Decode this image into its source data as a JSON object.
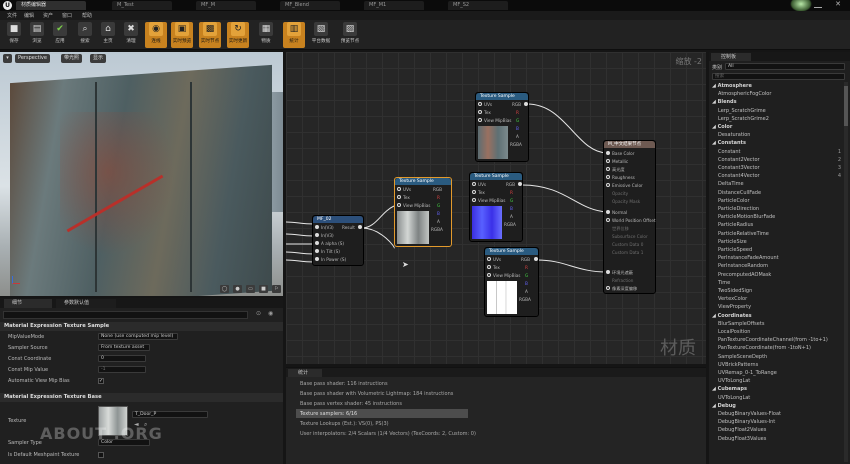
{
  "titlebar": {
    "tabs": [
      "M_Test",
      "MF_M",
      "MF_Blend",
      "MF_M1",
      "MF_S2"
    ],
    "active_tab": "材质编辑器"
  },
  "menubar": {
    "items": [
      "文件",
      "编辑",
      "资产",
      "窗口",
      "帮助"
    ]
  },
  "toolbar": {
    "buttons": [
      {
        "label": "保存",
        "icon": "save-icon",
        "glyph": "■"
      },
      {
        "label": "浏览",
        "icon": "browse-icon",
        "glyph": "▤"
      },
      {
        "label": "应用",
        "icon": "apply-icon",
        "glyph": "✔"
      },
      {
        "label": "搜索",
        "icon": "search-icon",
        "glyph": "⌕"
      },
      {
        "label": "主页",
        "icon": "home-icon",
        "glyph": "⌂"
      },
      {
        "label": "清理",
        "icon": "clean-icon",
        "glyph": "✖"
      },
      {
        "label": "连线",
        "icon": "connectors-icon",
        "glyph": "◉"
      },
      {
        "label": "实时预览",
        "icon": "live-preview-icon",
        "glyph": "▣"
      },
      {
        "label": "实时节点",
        "icon": "live-nodes-icon",
        "glyph": "▩"
      },
      {
        "label": "实时更新",
        "icon": "live-update-icon",
        "glyph": "↻"
      },
      {
        "label": "物质",
        "icon": "hlsl-icon",
        "glyph": "▦"
      },
      {
        "label": "统计",
        "icon": "stats-icon",
        "glyph": "▥"
      },
      {
        "label": "平台数据",
        "icon": "platform-icon",
        "glyph": "▧"
      },
      {
        "label": "预览节点",
        "icon": "preview-nodes-icon",
        "glyph": "▨"
      }
    ]
  },
  "viewport": {
    "buttons": [
      "Perspective",
      "带光照",
      "显示"
    ]
  },
  "details": {
    "tabs": [
      "细节",
      "参数默认值"
    ],
    "section1": "Material Expression Texture Sample",
    "rows": [
      {
        "label": "MipValueMode",
        "value": "None (use computed mip level)"
      },
      {
        "label": "Sampler Source",
        "value": "From texture asset"
      },
      {
        "label": "Const Coordinate",
        "value": "0"
      },
      {
        "label": "Const Mip Value",
        "value": "-1"
      },
      {
        "label": "Automatic View Mip Bias",
        "value": "✓"
      }
    ],
    "section2": "Material Expression Texture Base",
    "texture_label": "Texture",
    "texture_value": "T_Door_P",
    "sampler_type_label": "Sampler Type",
    "sampler_type_value": "Color",
    "default_mesh_label": "Is Default Meshpaint Texture"
  },
  "graph": {
    "zoom": "缩放 -2",
    "watermark": "材质",
    "nodes": {
      "mf": {
        "title": "MF_02",
        "pins": [
          "In(V3)",
          "In(V3)",
          "A alpha (S)",
          "In Tilt (S)",
          "In Power (S)"
        ],
        "out": "Result"
      },
      "t1": {
        "title": "Texture Sample",
        "pins": [
          "UVs",
          "Tex",
          "View MipBias"
        ],
        "outs": [
          "RGB",
          "R",
          "G",
          "B",
          "A",
          "RGBA"
        ]
      },
      "t2": {
        "title": "Texture Sample",
        "pins": [
          "UVs",
          "Tex",
          "View MipBias"
        ],
        "outs": [
          "RGB",
          "R",
          "G",
          "B",
          "A",
          "RGBA"
        ]
      },
      "t3": {
        "title": "Texture Sample",
        "pins": [
          "UVs",
          "Tex",
          "View MipBias"
        ],
        "outs": [
          "RGB",
          "R",
          "G",
          "B",
          "A",
          "RGBA"
        ]
      },
      "t4": {
        "title": "Texture Sample",
        "pins": [
          "UVs",
          "Tex",
          "View MipBias"
        ],
        "outs": [
          "RGB",
          "R",
          "G",
          "B",
          "A",
          "RGBA"
        ]
      },
      "result": {
        "title": "M_中文结果节点",
        "pins": [
          "Base Color",
          "Metallic",
          "高光度",
          "Roughness",
          "Emissive Color",
          "Opacity",
          "Opacity Mask",
          "Normal",
          "World Position Offset",
          "世界位移",
          "Subsurface Color",
          "Custom Data 0",
          "Custom Data 1",
          "环境光遮蔽",
          "Refraction",
          "像素深度偏移"
        ]
      }
    }
  },
  "stats": {
    "tab": "统计",
    "lines": [
      "Base pass shader: 116 instructions",
      "Base pass shader with Volumetric Lightmap: 184 instructions",
      "Base pass vertex shader: 45 instructions",
      "Texture samplers: 6/16",
      "Texture Lookups (Est.): VS(0), PS(3)",
      "User interpolators: 2/4 Scalars (1/4 Vectors) (TexCoords: 2, Custom: 0)"
    ]
  },
  "palette": {
    "tab": "控制板",
    "filter_label": "类别",
    "filter_value": "All",
    "search_placeholder": "搜索",
    "items": [
      {
        "t": "Atmosphere",
        "c": 1
      },
      {
        "t": "AtmosphericFogColor"
      },
      {
        "t": "Blends",
        "c": 1
      },
      {
        "t": "Lerp_ScratchGrime"
      },
      {
        "t": "Lerp_ScratchGrime2"
      },
      {
        "t": "Color",
        "c": 1
      },
      {
        "t": "Desaturation"
      },
      {
        "t": "Constants",
        "c": 1
      },
      {
        "t": "Constant",
        "n": "1"
      },
      {
        "t": "Constant2Vector",
        "n": "2"
      },
      {
        "t": "Constant3Vector",
        "n": "3"
      },
      {
        "t": "Constant4Vector",
        "n": "4"
      },
      {
        "t": "DeltaTime"
      },
      {
        "t": "DistanceCullFade"
      },
      {
        "t": "ParticleColor"
      },
      {
        "t": "ParticleDirection"
      },
      {
        "t": "ParticleMotionBlurFade"
      },
      {
        "t": "ParticleRadius"
      },
      {
        "t": "ParticleRelativeTime"
      },
      {
        "t": "ParticleSize"
      },
      {
        "t": "ParticleSpeed"
      },
      {
        "t": "PerInstanceFadeAmount"
      },
      {
        "t": "PerInstanceRandom"
      },
      {
        "t": "PrecomputedAOMask"
      },
      {
        "t": "Time"
      },
      {
        "t": "TwoSidedSign"
      },
      {
        "t": "VertexColor"
      },
      {
        "t": "ViewProperty"
      },
      {
        "t": "Coordinates",
        "c": 1
      },
      {
        "t": "BlurSampleOffsets"
      },
      {
        "t": "LocalPosition"
      },
      {
        "t": "PanTextureCoordinateChannel(from -1to+1)"
      },
      {
        "t": "PanTextureCoordinate(from -1toN+1)"
      },
      {
        "t": "SampleSceneDepth"
      },
      {
        "t": "UVBrickPatterns"
      },
      {
        "t": "UVRemap_0-1_ToRange"
      },
      {
        "t": "UVToLongLat"
      },
      {
        "t": "Cubemaps",
        "c": 1
      },
      {
        "t": "UVToLongLat"
      },
      {
        "t": "Debug",
        "c": 1
      },
      {
        "t": "DebugBinaryValues-Float"
      },
      {
        "t": "DebugBinaryValues-Int"
      },
      {
        "t": "DebugFloat2Values"
      },
      {
        "t": "DebugFloat3Values"
      }
    ]
  },
  "watermark": "ABOUT    .ORG"
}
